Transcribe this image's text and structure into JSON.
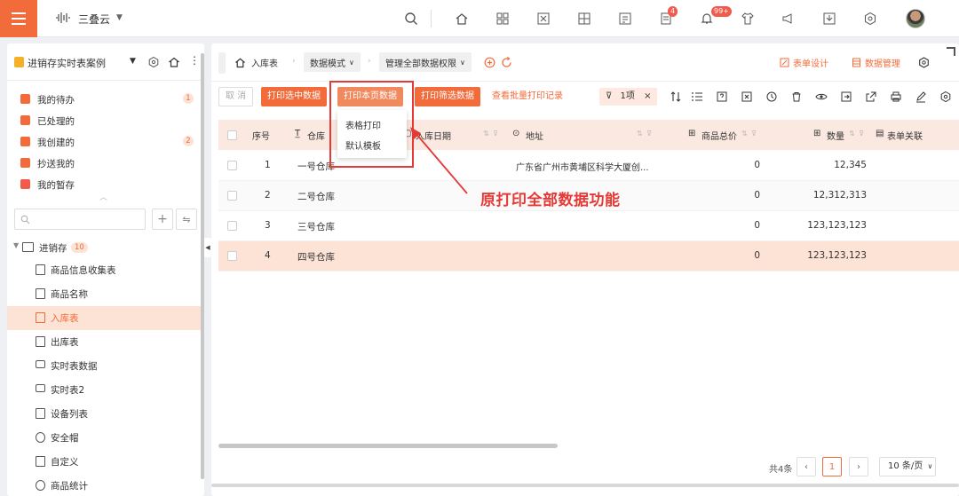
{
  "header": {
    "app_name": "三叠云",
    "badges": {
      "tasks": "4",
      "notifications": "99+"
    }
  },
  "sidebar": {
    "title": "进销存实时表案例",
    "quick_items": [
      {
        "label": "我的待办",
        "count": "1"
      },
      {
        "label": "已处理的",
        "count": ""
      },
      {
        "label": "我创建的",
        "count": "2"
      },
      {
        "label": "抄送我的",
        "count": ""
      },
      {
        "label": "我的暂存",
        "count": ""
      }
    ],
    "search": {
      "placeholder": ""
    },
    "tree_root": {
      "label": "进销存",
      "count": "10"
    },
    "tree_items": [
      {
        "label": "商品信息收集表"
      },
      {
        "label": "商品名称"
      },
      {
        "label": "入库表"
      },
      {
        "label": "出库表"
      },
      {
        "label": "实时表数据"
      },
      {
        "label": "实时表2"
      },
      {
        "label": "设备列表"
      },
      {
        "label": "安全帽"
      },
      {
        "label": "自定义"
      },
      {
        "label": "商品统计"
      }
    ]
  },
  "breadcrumb": {
    "current": "入库表",
    "data_mode": "数据模式",
    "permission": "管理全部数据权限"
  },
  "actions": {
    "form_design": "表单设计",
    "data_management": "数据管理"
  },
  "toolbar": {
    "cancel": "取 消",
    "print_selected": "打印选中数据",
    "print_page": "打印本页数据",
    "print_filtered": "打印筛选数据",
    "print_history": "查看批量打印记录",
    "filter_chip": "1项"
  },
  "dropdown": {
    "options": [
      "表格打印",
      "默认模板"
    ]
  },
  "table": {
    "columns": {
      "index": "序号",
      "warehouse": "仓库",
      "date": "入库日期",
      "address": "地址",
      "total_price": "商品总价",
      "quantity": "数量",
      "relation": "表单关联"
    },
    "rows": [
      {
        "index": "1",
        "warehouse": "一号仓库",
        "address": "广东省广州市黄埔区科学大厦创...",
        "total_price": "0",
        "quantity": "12,345"
      },
      {
        "index": "2",
        "warehouse": "二号仓库",
        "address": "",
        "total_price": "0",
        "quantity": "12,312,313"
      },
      {
        "index": "3",
        "warehouse": "三号仓库",
        "address": "",
        "total_price": "0",
        "quantity": "123,123,123"
      },
      {
        "index": "4",
        "warehouse": "四号仓库",
        "address": "",
        "total_price": "0",
        "quantity": "123,123,123"
      }
    ]
  },
  "pagination": {
    "total": "共4条",
    "current_page": "1",
    "page_size": "10 条/页"
  },
  "annotation": {
    "text": "原打印全部数据功能"
  },
  "colors": {
    "accent": "#f26b3a",
    "annotation": "#e53935",
    "header_bg": "#fbe9e1",
    "selected_row": "#fde3d6"
  }
}
